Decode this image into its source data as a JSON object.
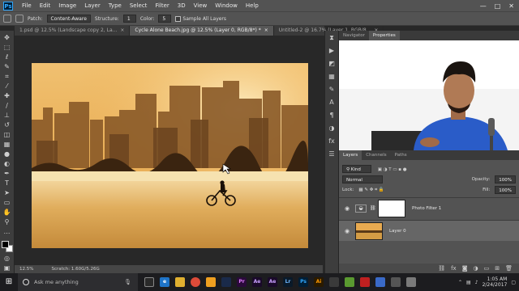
{
  "app": {
    "logo": "Ps"
  },
  "menu": [
    "File",
    "Edit",
    "Image",
    "Layer",
    "Type",
    "Select",
    "Filter",
    "3D",
    "View",
    "Window",
    "Help"
  ],
  "window_controls": [
    "—",
    "□",
    "✕"
  ],
  "options": {
    "patch_label": "Patch:",
    "patch_value": "Content-Aware",
    "structure_label": "Structure:",
    "structure_value": "1",
    "color_label": "Color:",
    "color_value": "5",
    "sample_all_label": "Sample All Layers"
  },
  "tabs": [
    {
      "label": "1.psd @ 12.5% (Landscape copy 2, La..."
    },
    {
      "label": "Cycle Alone Beach.jpg @ 12.5% (Layer 0, RGB/8*) *"
    },
    {
      "label": "Untitled-2 @ 16.7% (Layer 1, RGB/8..."
    }
  ],
  "status": {
    "zoom": "12.5%",
    "scratch": "Scratch: 1.60G/5.26G"
  },
  "side_tabs": {
    "navigator": "Navigator",
    "properties": "Properties"
  },
  "layers": {
    "tabs": [
      "Layers",
      "Channels",
      "Paths"
    ],
    "kind": "Kind",
    "blend_mode": "Normal",
    "opacity_label": "Opacity:",
    "opacity_value": "100%",
    "lock_label": "Lock:",
    "fill_label": "Fill:",
    "fill_value": "100%",
    "items": [
      {
        "name": "Photo Filter 1"
      },
      {
        "name": "Layer 0"
      }
    ]
  },
  "taskbar": {
    "search_placeholder": "Ask me anything",
    "time": "1:05 AM",
    "date": "2/24/2017",
    "app_icons": [
      "e",
      "",
      "",
      "",
      "",
      "Pr",
      "Ae",
      "Ae",
      "Lr",
      "",
      "Ai",
      "",
      "",
      "",
      "",
      "",
      ""
    ]
  },
  "colors": {
    "ui_dark": "#535353",
    "panel": "#3d3d3d",
    "taskbar": "#1c1c1f",
    "photo_sky": "#e8a94a",
    "photo_sand": "#d49c45"
  }
}
